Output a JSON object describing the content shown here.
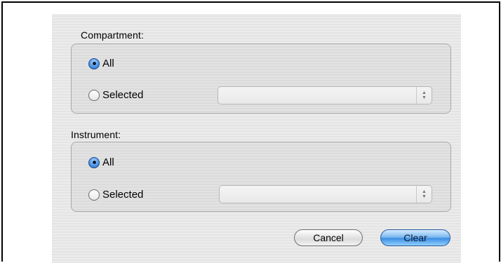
{
  "compartment": {
    "label": "Compartment:",
    "option_all": "All",
    "option_selected": "Selected",
    "selected_option": "All",
    "popup_value": ""
  },
  "instrument": {
    "label": "Instrument:",
    "option_all": "All",
    "option_selected": "Selected",
    "selected_option": "All",
    "popup_value": ""
  },
  "buttons": {
    "cancel": "Cancel",
    "clear": "Clear"
  },
  "colors": {
    "default_button": "#3f8ee3",
    "group_border": "#a9a9a9"
  }
}
